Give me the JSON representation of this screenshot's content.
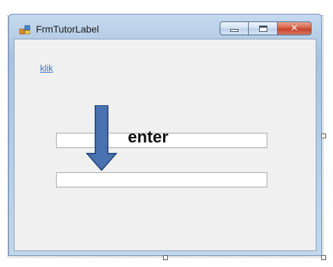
{
  "window": {
    "title": "FrmTutorLabel",
    "icon": "form-app-icon",
    "controls": {
      "minimize_icon": "minimize-icon",
      "maximize_icon": "maximize-icon",
      "close_icon": "close-icon",
      "close_glyph": "✕"
    }
  },
  "form": {
    "link_label": "klik",
    "textbox1": {
      "value": ""
    },
    "textbox2": {
      "value": ""
    }
  },
  "annotation": {
    "text": "enter",
    "arrow_icon": "arrow-down-icon",
    "arrow_color": "#4a72b0"
  },
  "colors": {
    "link": "#3b74c8",
    "close_button": "#c7432a",
    "client_background": "#f0f0f0"
  }
}
